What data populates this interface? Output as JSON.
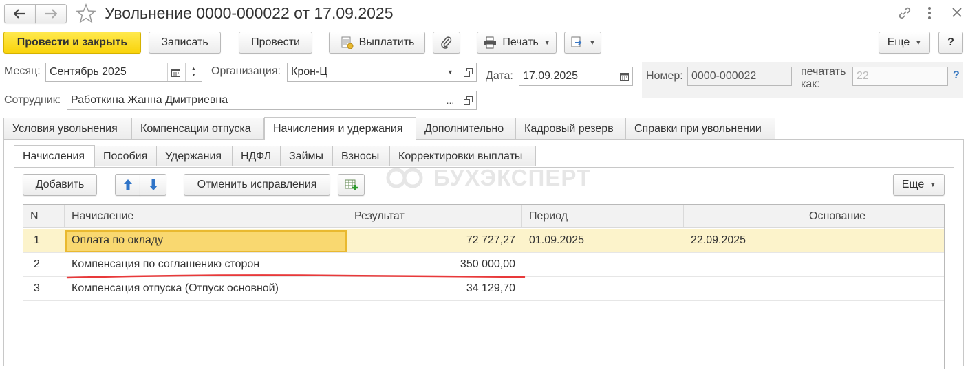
{
  "window": {
    "title": "Увольнение 0000-000022 от 17.09.2025"
  },
  "toolbar": {
    "post_close_label": "Провести и закрыть",
    "save_label": "Записать",
    "post_label": "Провести",
    "pay_label": "Выплатить",
    "print_label": "Печать",
    "more_label": "Еще",
    "help_label": "?"
  },
  "header": {
    "month_label": "Месяц:",
    "month_value": "Сентябрь 2025",
    "org_label": "Организация:",
    "org_value": "Крон-Ц",
    "date_label": "Дата:",
    "date_value": "17.09.2025",
    "number_label": "Номер:",
    "number_value": "0000-000022",
    "print_as_label_1": "печатать",
    "print_as_label_2": "как:",
    "print_as_value": "22",
    "help_mark": "?",
    "employee_label": "Сотрудник:",
    "employee_value": "Работкина Жанна Дмитриевна",
    "select_button": "..."
  },
  "tabs": [
    {
      "label": "Условия увольнения"
    },
    {
      "label": "Компенсации отпуска"
    },
    {
      "label": "Начисления и удержания"
    },
    {
      "label": "Дополнительно"
    },
    {
      "label": "Кадровый резерв"
    },
    {
      "label": "Справки при увольнении"
    }
  ],
  "subtabs": [
    {
      "label": "Начисления"
    },
    {
      "label": "Пособия"
    },
    {
      "label": "Удержания"
    },
    {
      "label": "НДФЛ"
    },
    {
      "label": "Займы"
    },
    {
      "label": "Взносы"
    },
    {
      "label": "Корректировки выплаты"
    }
  ],
  "table_toolbar": {
    "add_label": "Добавить",
    "cancel_corrections_label": "Отменить исправления",
    "more_label": "Еще"
  },
  "watermark": "БУХЭКСПЕРТ",
  "table": {
    "columns": [
      "N",
      "Начисление",
      "Результат",
      "Период",
      "",
      "Основание"
    ],
    "rows": [
      {
        "n": "1",
        "accrual": "Оплата по окладу",
        "result": "72 727,27",
        "period_from": "01.09.2025",
        "period_to": "22.09.2025",
        "basis": ""
      },
      {
        "n": "2",
        "accrual": "Компенсация по соглашению сторон",
        "result": "350 000,00",
        "period_from": "",
        "period_to": "",
        "basis": ""
      },
      {
        "n": "3",
        "accrual": "Компенсация отпуска (Отпуск основной)",
        "result": "34 129,70",
        "period_from": "",
        "period_to": "",
        "basis": ""
      }
    ]
  },
  "colors": {
    "primary_button": "#f9d30b",
    "selected_row": "#fcf3cb",
    "selected_cell": "#f9d870",
    "underline_annotation": "#e8393a"
  }
}
